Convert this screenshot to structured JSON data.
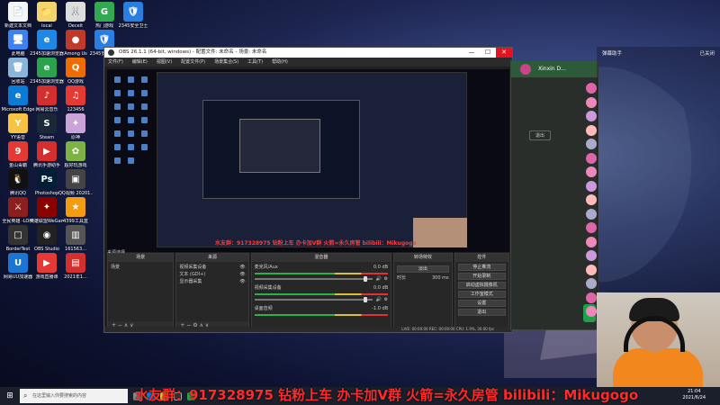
{
  "desktop": {
    "icons": [
      {
        "label": "新建文本文档",
        "color": "#f5f5f5",
        "glyph": "📄",
        "col": 0,
        "row": 0
      },
      {
        "label": "local",
        "color": "#f5d36b",
        "glyph": "📁",
        "col": 1,
        "row": 0
      },
      {
        "label": "Deceit",
        "color": "#ddd",
        "glyph": "🐰",
        "col": 2,
        "row": 0
      },
      {
        "label": "热门游戏",
        "color": "#33a852",
        "glyph": "G",
        "col": 3,
        "row": 0
      },
      {
        "label": "2345安全卫士",
        "color": "#2a7de1",
        "glyph": "🛡",
        "col": 4,
        "row": 0
      },
      {
        "label": "此电脑",
        "color": "#3b82f6",
        "glyph": "🖥",
        "col": 0,
        "row": 1
      },
      {
        "label": "2345加速浏览器",
        "color": "#1e88e5",
        "glyph": "e",
        "col": 1,
        "row": 1
      },
      {
        "label": "Among Us",
        "color": "#c0392b",
        "glyph": "●",
        "col": 2,
        "row": 1
      },
      {
        "label": "2345安全卫士",
        "color": "#2a7de1",
        "glyph": "🛡",
        "col": 3,
        "row": 1
      },
      {
        "label": "回收站",
        "color": "#8ab4d8",
        "glyph": "🗑",
        "col": 0,
        "row": 2
      },
      {
        "label": "2345加速浏览器",
        "color": "#2ba24c",
        "glyph": "e",
        "col": 1,
        "row": 2
      },
      {
        "label": "QQ游戏",
        "color": "#ef6c00",
        "glyph": "Q",
        "col": 2,
        "row": 2
      },
      {
        "label": "Microsoft Edge",
        "color": "#0a7cd6",
        "glyph": "e",
        "col": 0,
        "row": 3
      },
      {
        "label": "网易云音乐",
        "color": "#d32f2f",
        "glyph": "♪",
        "col": 1,
        "row": 3
      },
      {
        "label": "123456",
        "color": "#e53935",
        "glyph": "♫",
        "col": 2,
        "row": 3
      },
      {
        "label": "YY语音",
        "color": "#f6c343",
        "glyph": "Y",
        "col": 0,
        "row": 4
      },
      {
        "label": "Steam",
        "color": "#1b2838",
        "glyph": "S",
        "col": 1,
        "row": 4
      },
      {
        "label": "原神",
        "color": "#caa4d8",
        "glyph": "✦",
        "col": 2,
        "row": 4
      },
      {
        "label": "金山毒霸",
        "color": "#e53935",
        "glyph": "9",
        "col": 0,
        "row": 5
      },
      {
        "label": "腾讯手游助手",
        "color": "#d32f2f",
        "glyph": "▶",
        "col": 1,
        "row": 5
      },
      {
        "label": "超好玩游戏",
        "color": "#7cb342",
        "glyph": "✿",
        "col": 2,
        "row": 5
      },
      {
        "label": "腾讯QQ",
        "color": "#111",
        "glyph": "🐧",
        "col": 0,
        "row": 6
      },
      {
        "label": "Photoshop",
        "color": "#001e36",
        "glyph": "Ps",
        "col": 1,
        "row": 6
      },
      {
        "label": "QQ视频 20201...",
        "color": "#444",
        "glyph": "▣",
        "col": 2,
        "row": 6
      },
      {
        "label": "全民英雄 -LOHI",
        "color": "#8d1e1e",
        "glyph": "⚔",
        "col": 0,
        "row": 7
      },
      {
        "label": "英雄联盟WeGame",
        "color": "#8b0000",
        "glyph": "✦",
        "col": 1,
        "row": 7
      },
      {
        "label": "4399工具盒",
        "color": "#f39c12",
        "glyph": "★",
        "col": 2,
        "row": 7
      },
      {
        "label": "BorderTest",
        "color": "#333",
        "glyph": "□",
        "col": 0,
        "row": 8
      },
      {
        "label": "OBS Studio",
        "color": "#222",
        "glyph": "◉",
        "col": 1,
        "row": 8
      },
      {
        "label": "161563...",
        "color": "#555",
        "glyph": "▥",
        "col": 2,
        "row": 8
      },
      {
        "label": "网易UU加速器",
        "color": "#1976d2",
        "glyph": "U",
        "col": 0,
        "row": 9
      },
      {
        "label": "游戏直播课",
        "color": "#e53935",
        "glyph": "▶",
        "col": 1,
        "row": 9
      },
      {
        "label": "2021年1...",
        "color": "#d32f2f",
        "glyph": "▤",
        "col": 2,
        "row": 9
      }
    ]
  },
  "obs": {
    "title": "OBS 26.1.1 (64-bit, windows) - 配置文件: 未命名 - 场景: 未命名",
    "menu": [
      "文件(F)",
      "编辑(E)",
      "视图(V)",
      "配置文件(P)",
      "场景集合(S)",
      "工具(T)",
      "帮助(H)"
    ],
    "window_controls": {
      "minimize": "—",
      "maximize": "☐",
      "close": "✕"
    },
    "scenes_tab": "来源选择",
    "panels": {
      "scenes": {
        "title": "场景",
        "items": [
          "场景"
        ]
      },
      "sources": {
        "title": "来源",
        "items": [
          "视频采集设备",
          "文本 (GDI+)",
          "显示器采集"
        ]
      },
      "mixer": {
        "title": "混音器",
        "channels": [
          {
            "name": "麦克风/Aux",
            "db": "0.0 dB"
          },
          {
            "name": "视频采集设备",
            "db": "0.0 dB"
          },
          {
            "name": "桌面音频",
            "db": "-1.0 dB"
          }
        ]
      },
      "transitions": {
        "title": "转场特效",
        "type": "淡出",
        "duration_label": "时长",
        "duration": "300 ms"
      },
      "controls": {
        "title": "控件",
        "buttons": [
          "停止推流",
          "开始录制",
          "启动虚拟摄像机",
          "工作室模式",
          "设置",
          "退出"
        ]
      }
    },
    "status": "LIVE: 00:00:00  REC: 00:00:00  CPU: 1.9%, 30.00 fps"
  },
  "preview": {
    "banner": "水友群：917328975 钻粉上车 办卡加V群 火箭=永久房管 bilibili：Mikugogo"
  },
  "right_app": {
    "title": "Xinxin D...",
    "logout": "退出"
  },
  "live_panel": {
    "header_left": "弹幕助手",
    "header_right": "已关闭"
  },
  "banner": "水友群：917328975 钻粉上车 办卡加V群 火箭=永久房管 bilibili：Mikugogo",
  "taskbar": {
    "search_placeholder": "在这里输入你要搜索的内容",
    "time": "21:04",
    "date": "2021/6/24"
  }
}
